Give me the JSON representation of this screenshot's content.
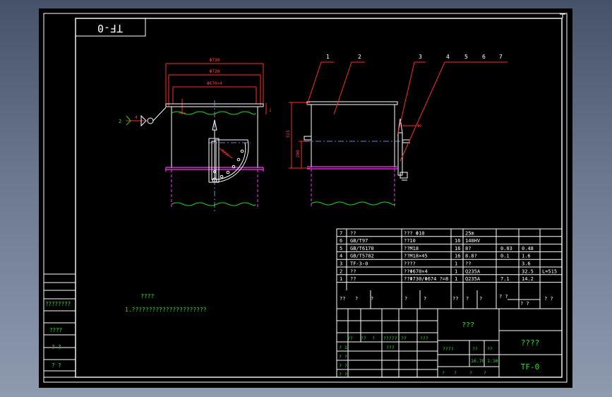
{
  "drawing": {
    "code_mirrored": "TF-0",
    "drawing_code": "TF-0",
    "drawing_name": "????",
    "material_title": "???",
    "scale_a": "16.78",
    "scale_b": "1:10",
    "tech_title": "????",
    "tech_note": "1.??????????????????????"
  },
  "front_view": {
    "dim_outer": "Φ730",
    "dim_mid": "Φ720",
    "dim_bolt": "Φ670×4",
    "leader_num": "2",
    "leader_sym": "4",
    "small_label": "1"
  },
  "side_view": {
    "dim_height": "515",
    "dim_half": "200",
    "dim_shaft": "Φ0",
    "balloons": [
      "1",
      "2",
      "3",
      "4",
      "5",
      "6",
      "7"
    ]
  },
  "bom": {
    "rows": [
      {
        "no": "7",
        "code": "??",
        "name": "??? Φ10",
        "qty": "",
        "material": "25m",
        "w1": "",
        "w2": "",
        "note": ""
      },
      {
        "no": "6",
        "code": "GB/T97",
        "name": "??10",
        "qty": "16",
        "material": "140HV",
        "w1": "",
        "w2": "",
        "note": ""
      },
      {
        "no": "5",
        "code": "GB/T6170",
        "name": "??M18",
        "qty": "16",
        "material": "8?",
        "w1": "0.03",
        "w2": "0.48",
        "note": ""
      },
      {
        "no": "4",
        "code": "GB/T5782",
        "name": "??M18×45",
        "qty": "16",
        "material": "8.8?",
        "w1": "0.1",
        "w2": "1.6",
        "note": ""
      },
      {
        "no": "3",
        "code": "TF-3-0",
        "name": "????",
        "qty": "1",
        "material": "??",
        "w1": "",
        "w2": "3.6",
        "note": ""
      },
      {
        "no": "2",
        "code": "??",
        "name": "??Φ670×4",
        "qty": "1",
        "material": "Q235A",
        "w1": "",
        "w2": "32.5",
        "note": "L=515"
      },
      {
        "no": "1",
        "code": "??",
        "name": "??Φ730/Φ674 ?=8",
        "qty": "1",
        "material": "Q235A",
        "w1": "7.1",
        "w2": "14.2",
        "note": ""
      }
    ],
    "header": [
      "??",
      "?",
      "?",
      "?",
      "?",
      "??",
      "?",
      "?",
      "? ?",
      "? ?",
      "? ?"
    ]
  },
  "left_strip": {
    "labels": [
      "????????",
      "????",
      "?  ?",
      "?  ?"
    ]
  },
  "title_block": {
    "rev_headers": [
      "??",
      "??",
      "?",
      "?????",
      "??",
      "???"
    ],
    "sign_rows": [
      "? 1",
      "? ?",
      "? ?",
      "? ?"
    ],
    "stage_label": "????",
    "weight_label": "??",
    "scale_label": "??",
    "sheet_labels": [
      "?",
      "?",
      "?",
      "?"
    ]
  }
}
